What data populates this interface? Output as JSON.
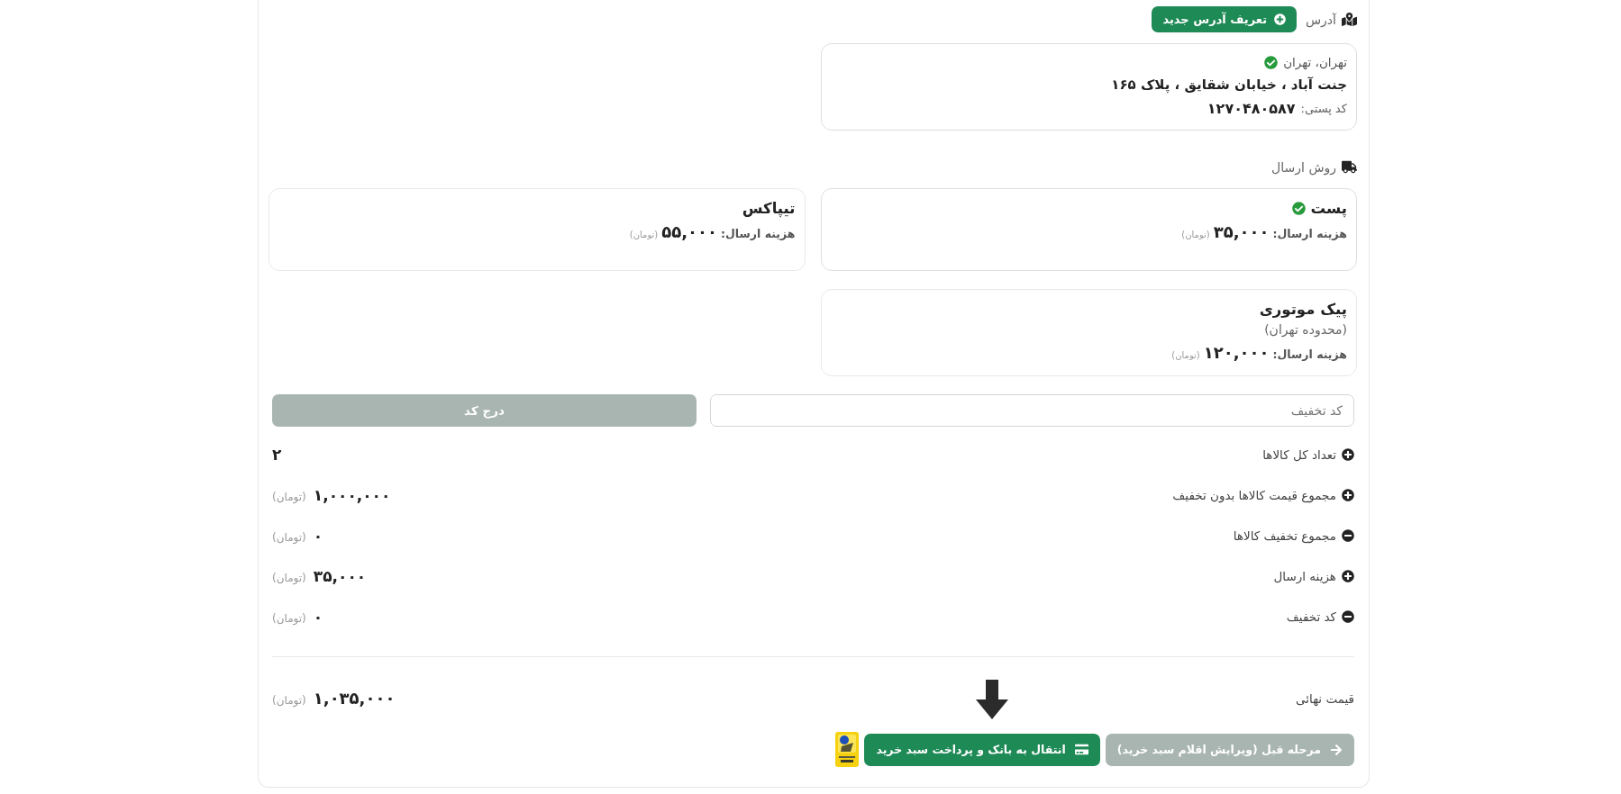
{
  "address": {
    "label": "آدرس",
    "add_button": "تعریف آدرس جدید",
    "items": [
      {
        "city": "تهران، تهران",
        "street": "جنت آباد ، خیابان شقایق ، پلاک ۱۶۵",
        "postal_label": "کد پستی:",
        "postal_code": "۱۲۷۰۴۸۰۵۸۷",
        "selected": true
      }
    ]
  },
  "shipping": {
    "label": "روش ارسال",
    "methods": [
      {
        "name": "پست",
        "cost_label": "هزینه ارسال:",
        "cost": "۳۵,۰۰۰",
        "currency": "(تومان)",
        "selected": true
      },
      {
        "name": "تیپاکس",
        "cost_label": "هزینه ارسال:",
        "cost": "۵۵,۰۰۰",
        "currency": "(تومان)",
        "selected": false
      },
      {
        "name": "پیک موتوری",
        "note": "(محدوده تهران)",
        "cost_label": "هزینه ارسال:",
        "cost": "۱۲۰,۰۰۰",
        "currency": "(تومان)",
        "selected": false
      }
    ]
  },
  "discount": {
    "placeholder": "کد تخفیف",
    "button": "درج کد"
  },
  "summary": {
    "rows": [
      {
        "kind": "plus",
        "label": "تعداد کل کالاها",
        "value": "۲"
      },
      {
        "kind": "plus",
        "label": "مجموع قیمت کالاها بدون تخفیف",
        "value": "۱,۰۰۰,۰۰۰",
        "currency": "(تومان)"
      },
      {
        "kind": "minus",
        "label": "مجموع تخفیف کالاها",
        "value": "۰",
        "currency": "(تومان)"
      },
      {
        "kind": "plus",
        "label": "هزینه ارسال",
        "value": "۳۵,۰۰۰",
        "currency": "(تومان)"
      },
      {
        "kind": "minus",
        "label": "کد تخفیف",
        "value": "۰",
        "currency": "(تومان)"
      }
    ],
    "total": {
      "label": "قیمت نهائی",
      "value": "۱,۰۳۵,۰۰۰",
      "currency": "(تومان)"
    }
  },
  "actions": {
    "back_button": "مرحله قبل (ویرایش اقلام سبد خرید)",
    "pay_button": "انتقال به بانک و پرداخت سبد خرید"
  }
}
